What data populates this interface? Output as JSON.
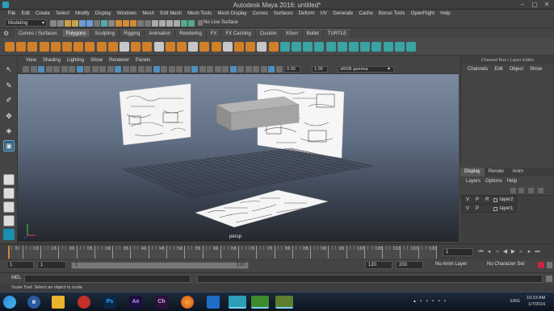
{
  "window": {
    "title": "Autodesk Maya 2016: untitled*"
  },
  "menubar": [
    "File",
    "Edit",
    "Create",
    "Select",
    "Modify",
    "Display",
    "Windows",
    "Mesh",
    "Edit Mesh",
    "Mesh Tools",
    "Mesh Display",
    "Curves",
    "Surfaces",
    "Deform",
    "UV",
    "Generate",
    "Cache",
    "Bonus Tools",
    "OpenFlight",
    "Help"
  ],
  "statusline": {
    "mode": "Modeling",
    "live_surface": "No Live Surface"
  },
  "shelf_tabs": [
    "Curves / Surfaces",
    "Polygons",
    "Sculpting",
    "Rigging",
    "Animation",
    "Rendering",
    "FX",
    "FX Caching",
    "Custom",
    "XGen",
    "Bullet",
    "TURTLE"
  ],
  "shelf_active": "Polygons",
  "viewport": {
    "menu": [
      "View",
      "Shading",
      "Lighting",
      "Show",
      "Renderer",
      "Panels"
    ],
    "near_value": "0.00",
    "far_value": "1.00",
    "color_space": "sRGB gamma",
    "camera_label": "persp"
  },
  "channel_box": {
    "header": "Channel Box / Layer Editor",
    "menu": [
      "Channels",
      "Edit",
      "Object",
      "Show"
    ]
  },
  "layer_editor": {
    "tabs": [
      "Display",
      "Render",
      "Anim"
    ],
    "active_tab": "Display",
    "menu": [
      "Layers",
      "Options",
      "Help"
    ],
    "layers": [
      {
        "v": "V",
        "p": "P",
        "r": "R",
        "name": "layer2"
      },
      {
        "v": "V",
        "p": "P",
        "r": "",
        "name": "layer1"
      }
    ]
  },
  "time_slider": {
    "ticks": [
      "5",
      "10",
      "15",
      "20",
      "25",
      "30",
      "35",
      "40",
      "45",
      "50",
      "55",
      "60",
      "65",
      "70",
      "75",
      "80",
      "85",
      "90",
      "95",
      "100",
      "105",
      "110",
      "115",
      "120"
    ],
    "current_frame": "1"
  },
  "range_slider": {
    "start": "1",
    "playback_start": "1",
    "range_start": "1",
    "range_end": "120",
    "playback_end": "120",
    "end": "200",
    "anim_layer": "No Anim Layer",
    "char_set": "No Character Set"
  },
  "command_line": {
    "label": "MEL"
  },
  "help_line": "Scale Tool: Select an object to scale.",
  "taskbar": {
    "apps": [
      "Ps",
      "Ae",
      "Ch"
    ],
    "lang": "ENG",
    "time": "10:23 AM",
    "date": "1/7/2016"
  },
  "colors": {
    "accent": "#48a8c8",
    "shelf_orange": "#d27f2a",
    "shelf_teal": "#3aa3a3",
    "viewport_top": "#7c8ba0",
    "viewport_bottom": "#24272d"
  }
}
